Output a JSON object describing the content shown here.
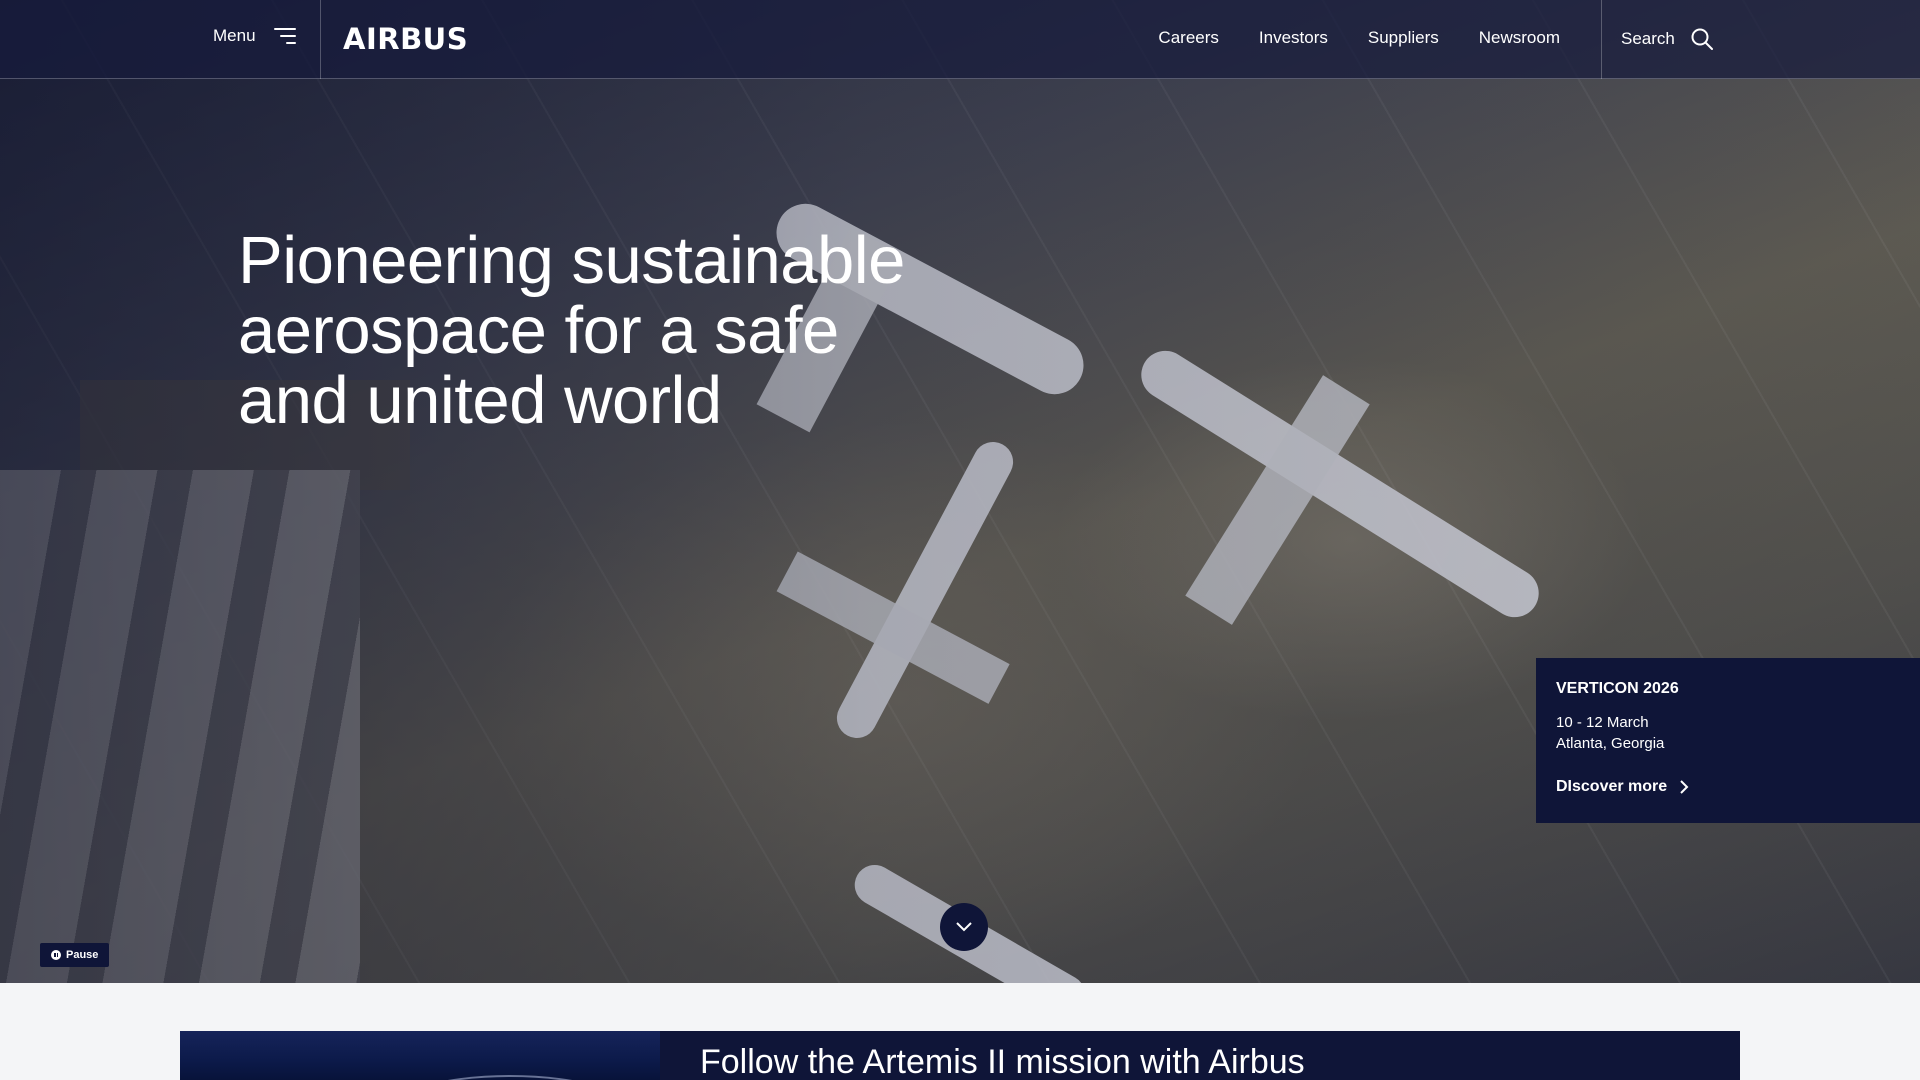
{
  "header": {
    "menu_label": "Menu",
    "logo_text": "AIRBUS",
    "nav": [
      "Careers",
      "Investors",
      "Suppliers",
      "Newsroom"
    ],
    "search_label": "Search"
  },
  "hero": {
    "headline_lines": [
      "Pioneering sustainable",
      "aerospace for a safe",
      "and united world"
    ],
    "pause_label": "Pause"
  },
  "event": {
    "title": "VERTICON 2026",
    "date": "10 - 12 March",
    "location": "Atlanta, Georgia",
    "link_label": "DIscover more"
  },
  "promo": {
    "title": "Follow the Artemis II mission with Airbus"
  },
  "colors": {
    "navy": "#0f1538",
    "header_bg": "rgba(22,26,60,0.72)",
    "white": "#ffffff"
  },
  "icons": {
    "menu": "menu-lines-icon",
    "search": "magnifier-icon",
    "chevron_right": "chevron-right-icon",
    "chevron_down": "chevron-down-icon",
    "pause": "pause-icon"
  }
}
